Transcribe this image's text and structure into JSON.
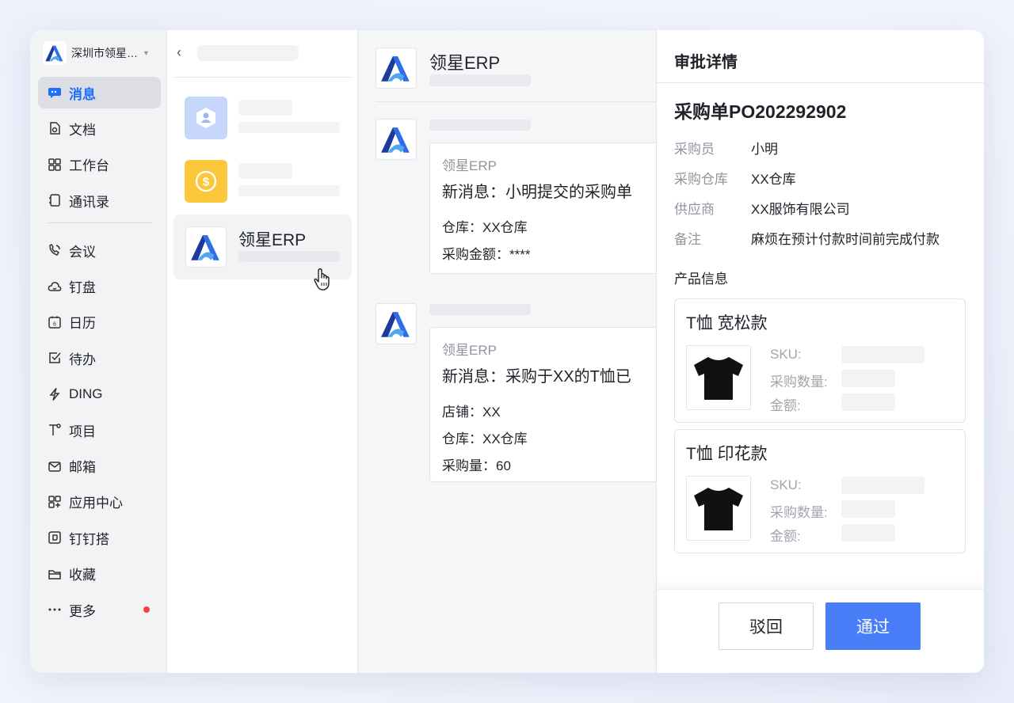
{
  "sidebar": {
    "org_name": "深圳市领星…",
    "items": [
      {
        "label": "消息",
        "icon": "message-icon",
        "active": true
      },
      {
        "label": "文档",
        "icon": "document-icon"
      },
      {
        "label": "工作台",
        "icon": "workbench-icon"
      },
      {
        "label": "通讯录",
        "icon": "contacts-icon"
      },
      {
        "label": "会议",
        "icon": "meeting-icon"
      },
      {
        "label": "钉盘",
        "icon": "cloud-drive-icon"
      },
      {
        "label": "日历",
        "icon": "calendar-icon"
      },
      {
        "label": "待办",
        "icon": "todo-icon"
      },
      {
        "label": "DING",
        "icon": "ding-icon"
      },
      {
        "label": "项目",
        "icon": "project-icon"
      },
      {
        "label": "邮箱",
        "icon": "mail-icon"
      },
      {
        "label": "应用中心",
        "icon": "app-center-icon"
      },
      {
        "label": "钉钉搭",
        "icon": "dingda-icon"
      },
      {
        "label": "收藏",
        "icon": "favorites-icon"
      },
      {
        "label": "更多",
        "icon": "more-icon",
        "badge": true
      }
    ]
  },
  "conversations": [
    {
      "name": "",
      "avatar_color": "#c7d6fb",
      "icon": "hexagon-user-icon"
    },
    {
      "name": "",
      "avatar_color": "#fcc83b",
      "icon": "dollar-coin-icon"
    },
    {
      "name": "领星ERP",
      "avatar": "erp-logo",
      "active": true
    }
  ],
  "chat": {
    "title": "领星ERP",
    "messages": [
      {
        "from": "领星ERP",
        "title": "新消息：小明提交的采购单",
        "lines": [
          "仓库：XX仓库",
          "采购金额：****"
        ]
      },
      {
        "from": "领星ERP",
        "title": "新消息：采购于XX的T恤已",
        "lines": [
          "店铺：XX",
          "仓库：XX仓库",
          "采购量：60"
        ]
      }
    ]
  },
  "detail": {
    "title": "审批详情",
    "order_no": "采购单PO202292902",
    "fields": [
      {
        "key": "采购员",
        "value": "小明"
      },
      {
        "key": "采购仓库",
        "value": "XX仓库"
      },
      {
        "key": "供应商",
        "value": "XX服饰有限公司"
      },
      {
        "key": "备注",
        "value": "麻烦在预计付款时间前完成付款"
      }
    ],
    "section_title": "产品信息",
    "products": [
      {
        "name": "T恤 宽松款",
        "labels": [
          "SKU:",
          "采购数量:",
          "金额:"
        ]
      },
      {
        "name": "T恤 印花款",
        "labels": [
          "SKU:",
          "采购数量:",
          "金额:"
        ]
      }
    ],
    "reject_label": "驳回",
    "approve_label": "通过"
  },
  "colors": {
    "accent": "#1e6fff",
    "approve": "#4a7df8",
    "badge": "#f5403c"
  }
}
